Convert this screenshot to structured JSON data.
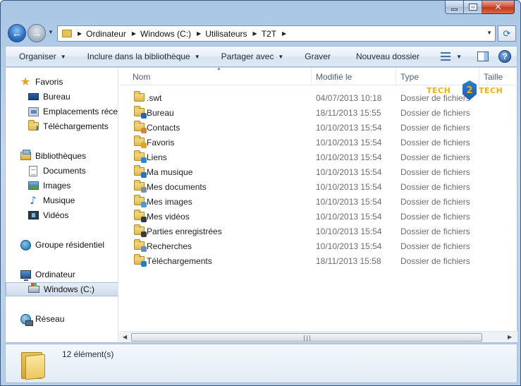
{
  "window": {
    "caption_minimize": "minimize",
    "caption_maximize": "maximize",
    "caption_close": "close",
    "accent": "#3a5a80"
  },
  "address": {
    "crumbs": [
      "Ordinateur",
      "Windows (C:)",
      "Utilisateurs",
      "T2T"
    ],
    "refresh_icon": "refresh-icon"
  },
  "toolbar": {
    "organiser": "Organiser",
    "include": "Inclure dans la bibliothèque",
    "share": "Partager avec",
    "burn": "Graver",
    "new_folder": "Nouveau dossier",
    "help": "?"
  },
  "navpane": {
    "favorites": {
      "label": "Favoris",
      "items": [
        "Bureau",
        "Emplacements récents",
        "Téléchargements"
      ]
    },
    "libraries": {
      "label": "Bibliothèques",
      "items": [
        "Documents",
        "Images",
        "Musique",
        "Vidéos"
      ]
    },
    "homegroup": "Groupe résidentiel",
    "computer": {
      "label": "Ordinateur",
      "items": [
        "Windows (C:)"
      ]
    },
    "network": "Réseau"
  },
  "columns": {
    "name": "Nom",
    "modified": "Modifié le",
    "type": "Type",
    "size": "Taille"
  },
  "files": [
    {
      "name": ".swt",
      "modified": "04/07/2013 10:18",
      "type": "Dossier de fichiers",
      "icon": "folder-icon"
    },
    {
      "name": "Bureau",
      "modified": "18/11/2013 15:55",
      "type": "Dossier de fichiers",
      "icon": "desktop-folder-icon"
    },
    {
      "name": "Contacts",
      "modified": "10/10/2013 15:54",
      "type": "Dossier de fichiers",
      "icon": "contacts-folder-icon"
    },
    {
      "name": "Favoris",
      "modified": "10/10/2013 15:54",
      "type": "Dossier de fichiers",
      "icon": "favorites-folder-icon"
    },
    {
      "name": "Liens",
      "modified": "10/10/2013 15:54",
      "type": "Dossier de fichiers",
      "icon": "links-folder-icon"
    },
    {
      "name": "Ma musique",
      "modified": "10/10/2013 15:54",
      "type": "Dossier de fichiers",
      "icon": "music-folder-icon"
    },
    {
      "name": "Mes documents",
      "modified": "10/10/2013 15:54",
      "type": "Dossier de fichiers",
      "icon": "documents-folder-icon"
    },
    {
      "name": "Mes images",
      "modified": "10/10/2013 15:54",
      "type": "Dossier de fichiers",
      "icon": "pictures-folder-icon"
    },
    {
      "name": "Mes vidéos",
      "modified": "10/10/2013 15:54",
      "type": "Dossier de fichiers",
      "icon": "videos-folder-icon"
    },
    {
      "name": "Parties enregistrées",
      "modified": "10/10/2013 15:54",
      "type": "Dossier de fichiers",
      "icon": "saved-games-folder-icon"
    },
    {
      "name": "Recherches",
      "modified": "10/10/2013 15:54",
      "type": "Dossier de fichiers",
      "icon": "searches-folder-icon"
    },
    {
      "name": "Téléchargements",
      "modified": "18/11/2013 15:58",
      "type": "Dossier de fichiers",
      "icon": "downloads-folder-icon"
    }
  ],
  "logo": {
    "left": "TECH",
    "center": "2",
    "right": "TECH"
  },
  "details": {
    "count": "12 élément(s)"
  }
}
